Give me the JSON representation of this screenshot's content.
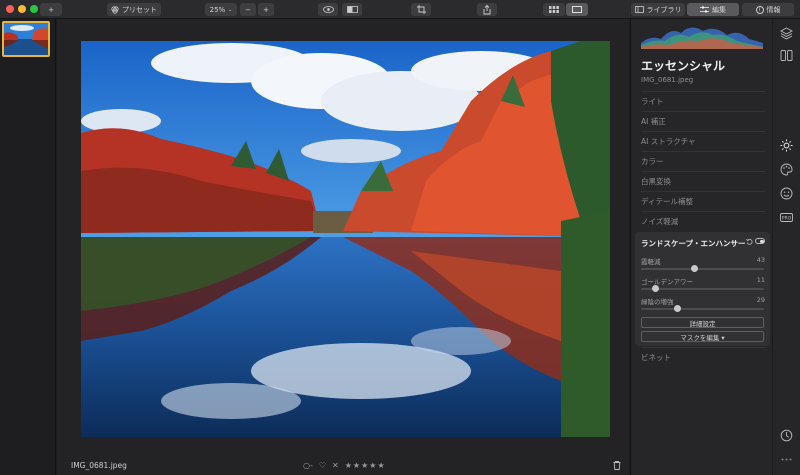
{
  "toolbar": {
    "add_label": "+",
    "presets_label": "プリセット",
    "zoom_value": "25%",
    "zoom_out_label": "−",
    "zoom_in_label": "+",
    "library_tab": "ライブラリ",
    "edit_tab": "編集",
    "info_tab": "情報"
  },
  "canvas": {
    "filename": "IMG_0681.jpeg",
    "rating_stars": "★★★★★",
    "reject_label": "✕",
    "circle_label": "○-",
    "heart_label": "♡"
  },
  "panel": {
    "title": "エッセンシャル",
    "filename": "IMG_0681.jpeg",
    "tools_top": [
      "ライト",
      "AI 補正",
      "AI ストラクチャ",
      "カラー",
      "白黒変換",
      "ディテール補整",
      "ノイズ軽減"
    ],
    "active_tool": {
      "title": "ランドスケープ・エンハンサー",
      "sliders": [
        {
          "label": "霞軽減",
          "value": "43",
          "fraction": 0.43
        },
        {
          "label": "ゴールデンアワー",
          "value": "11",
          "fraction": 0.11
        },
        {
          "label": "緑陰の増強",
          "value": "29",
          "fraction": 0.29
        }
      ],
      "advanced_button": "詳細設定",
      "mask_button": "マスクを編集 ▾"
    },
    "tools_bottom": [
      "ビネット"
    ]
  },
  "rail_icons": [
    "layers-icon",
    "compare-icon",
    "sun-icon",
    "palette-icon",
    "face-icon",
    "pro-icon",
    "history-icon",
    "more-icon"
  ],
  "colors": {
    "accent": "#e8b63c",
    "sky": "#2f7fd6",
    "foliage": "#d2482e"
  }
}
